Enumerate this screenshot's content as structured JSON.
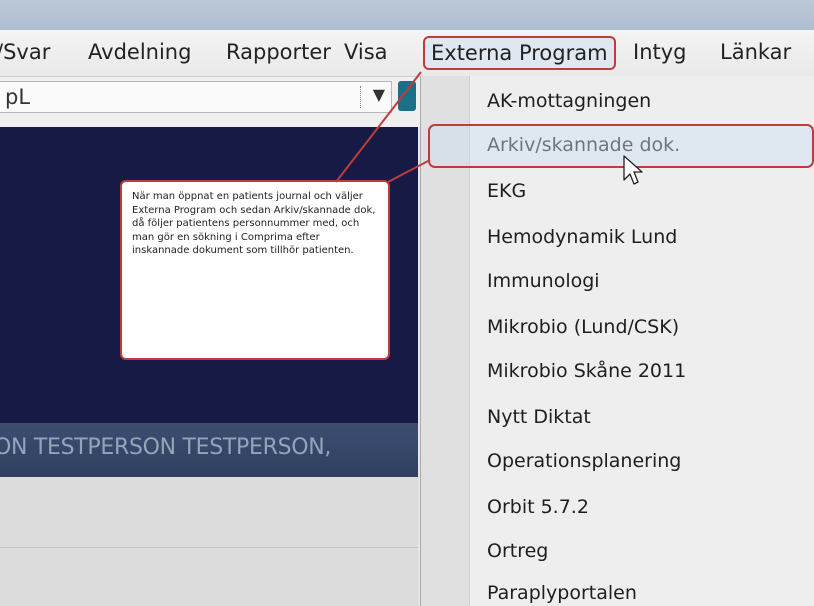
{
  "menubar": {
    "items": [
      "/Svar",
      "Avdelning",
      "Rapporter",
      "Visa",
      "Externa Program",
      "Intyg",
      "Länkar"
    ]
  },
  "toolbar": {
    "combo_value": "pL"
  },
  "patient": {
    "name": "ON TESTPERSON TESTPERSON,"
  },
  "dropdown": {
    "items": [
      "AK-mottagningen",
      "Arkiv/skannade dok.",
      "EKG",
      "Hemodynamik Lund",
      "Immunologi",
      "Mikrobio (Lund/CSK)",
      "Mikrobio Skåne 2011",
      "Nytt Diktat",
      "Operationsplanering",
      "Orbit 5.7.2",
      "Ortreg",
      "Paraplyportalen"
    ]
  },
  "callout": {
    "text": "När man öppnat en patients journal och väljer Externa Program och sedan Arkiv/skannade dok, då följer patientens personnummer med, och man gör en sökning i Comprima efter inskannade dokument som tillhör patienten."
  },
  "colors": {
    "annotation_red": "#c03b3b",
    "navy_panel": "#161a44",
    "patient_bar": "#34466a"
  },
  "icons": [
    "chevron-down-icon",
    "mouse-pointer-icon"
  ]
}
